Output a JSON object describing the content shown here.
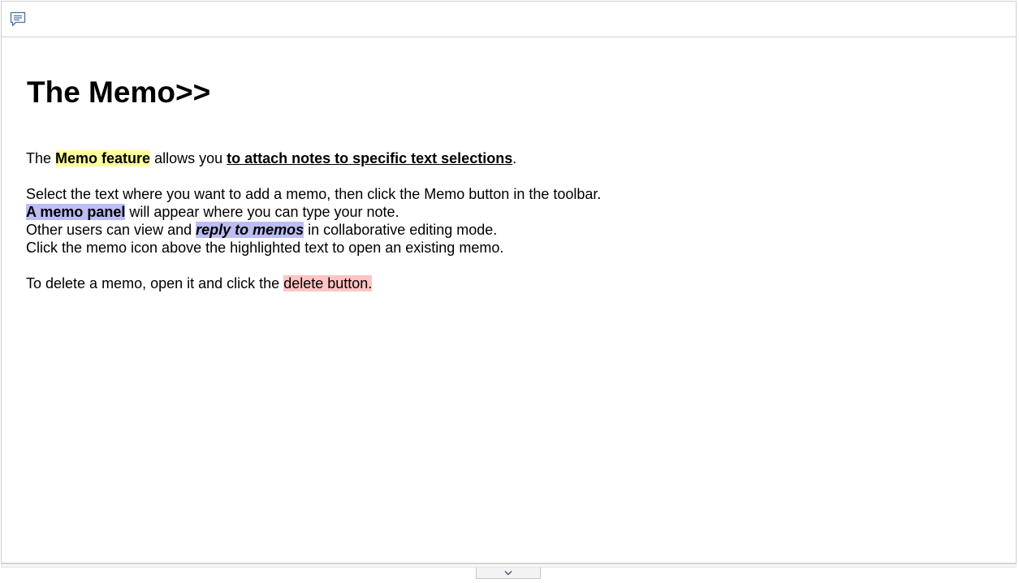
{
  "toolbar": {
    "memo_icon": "comment-icon"
  },
  "document": {
    "title": "The Memo>>",
    "paragraph1": {
      "t1": "The ",
      "t2": "Memo feature",
      "t3": " allows you ",
      "t4": "to attach notes to specific text selections",
      "t5": "."
    },
    "paragraph2": {
      "line1": "Select the text where you want to add a memo, then click the Memo button in the toolbar.",
      "line2_hl": "A memo panel",
      "line2_rest": " will appear where you can type your note.",
      "line3_a": "Other users can view and ",
      "line3_hl": "reply to memos",
      "line3_b": " in collaborative editing mode.",
      "line4": "Click the memo icon above the highlighted text to open an existing memo."
    },
    "paragraph3": {
      "t1": "To delete a memo, open it and click the ",
      "t2": "delete button."
    }
  },
  "footer": {
    "expand_icon": "chevron-down-icon"
  },
  "colors": {
    "yellow_highlight": "#ffff99",
    "blue_highlight": "#bdbdf5",
    "red_highlight": "#ffc4c4"
  }
}
